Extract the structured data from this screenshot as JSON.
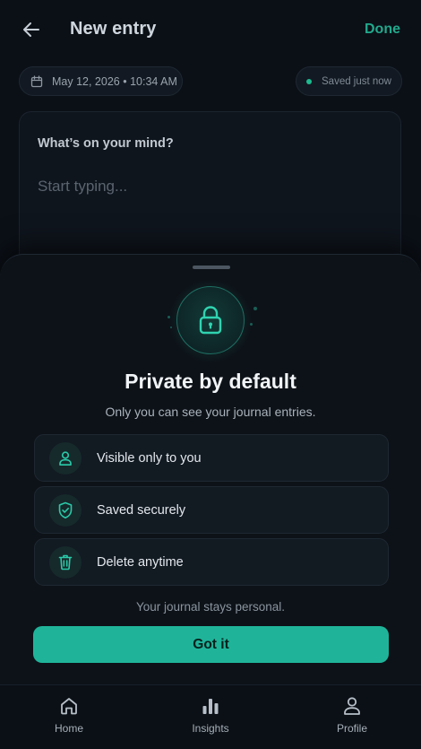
{
  "header": {
    "title": "New entry",
    "done_label": "Done"
  },
  "meta": {
    "datetime": "May 12, 2026 • 10:34 AM",
    "save_status": "Saved just now"
  },
  "editor": {
    "prompt": "What’s on your mind?",
    "placeholder": "Start typing..."
  },
  "privacy_sheet": {
    "title": "Private by default",
    "subtitle": "Only you can see your journal entries.",
    "features": [
      {
        "icon": "user-icon",
        "label": "Visible only to you"
      },
      {
        "icon": "shield-check-icon",
        "label": "Saved securely"
      },
      {
        "icon": "trash-icon",
        "label": "Delete anytime"
      }
    ],
    "footnote": "Your journal stays personal.",
    "button_label": "Got it"
  },
  "nav": {
    "items": [
      {
        "icon": "home-icon",
        "label": "Home"
      },
      {
        "icon": "bar-chart-icon",
        "label": "Insights"
      },
      {
        "icon": "profile-icon",
        "label": "Profile"
      }
    ]
  },
  "colors": {
    "accent": "#1fb49a",
    "background": "#0b1017"
  }
}
